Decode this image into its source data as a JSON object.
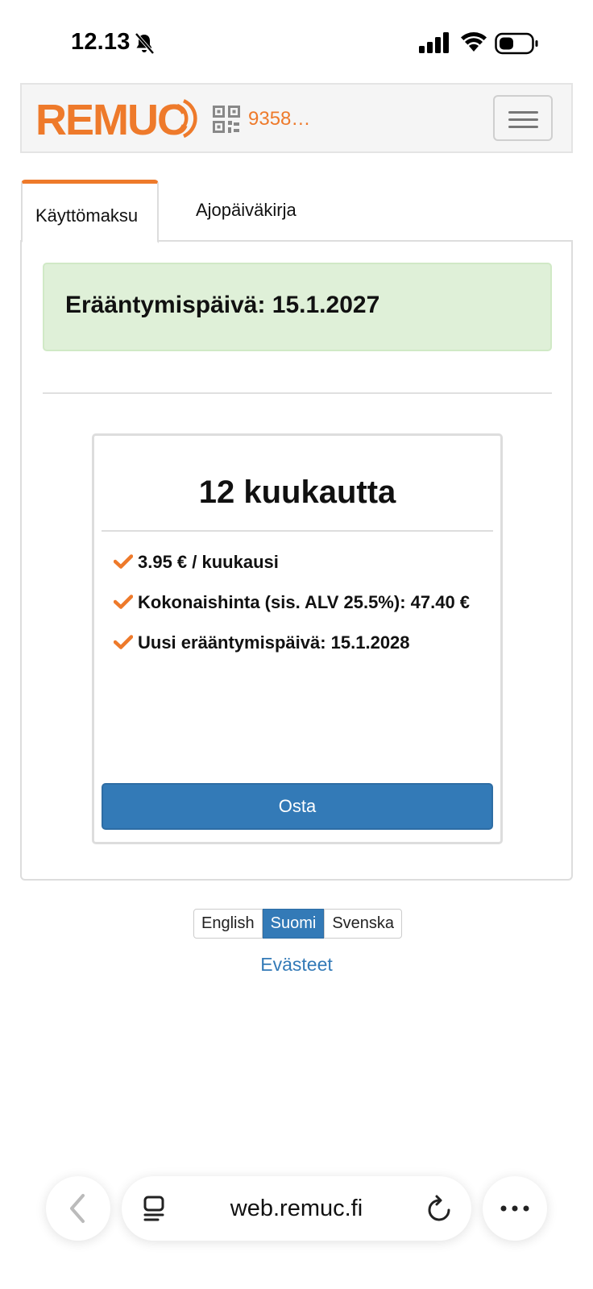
{
  "status_bar": {
    "time": "12.13"
  },
  "navbar": {
    "logo_text": "REMUC",
    "vehicle_id": "9358…",
    "icons": {
      "qr": "qr-code-icon",
      "menu": "hamburger-menu-icon"
    }
  },
  "tabs": [
    {
      "label": "Käyttömaksu",
      "active": true
    },
    {
      "label": "Ajopäiväkirja",
      "active": false
    }
  ],
  "alert": {
    "text": "Erääntymispäivä: 15.1.2027"
  },
  "plan": {
    "title": "12 kuukautta",
    "features": [
      "3.95 € / kuukausi",
      "Kokonaishinta (sis. ALV 25.5%): 47.40 €",
      "Uusi erääntymispäivä: 15.1.2028"
    ],
    "buy_label": "Osta"
  },
  "languages": [
    {
      "label": "English",
      "active": false
    },
    {
      "label": "Suomi",
      "active": true
    },
    {
      "label": "Svenska",
      "active": false
    }
  ],
  "cookies_link": "Evästeet",
  "browser": {
    "url": "web.remuc.fi"
  },
  "colors": {
    "brand_orange": "#ee7a2b",
    "primary_blue": "#337ab7",
    "success_bg": "#dff0d8"
  }
}
